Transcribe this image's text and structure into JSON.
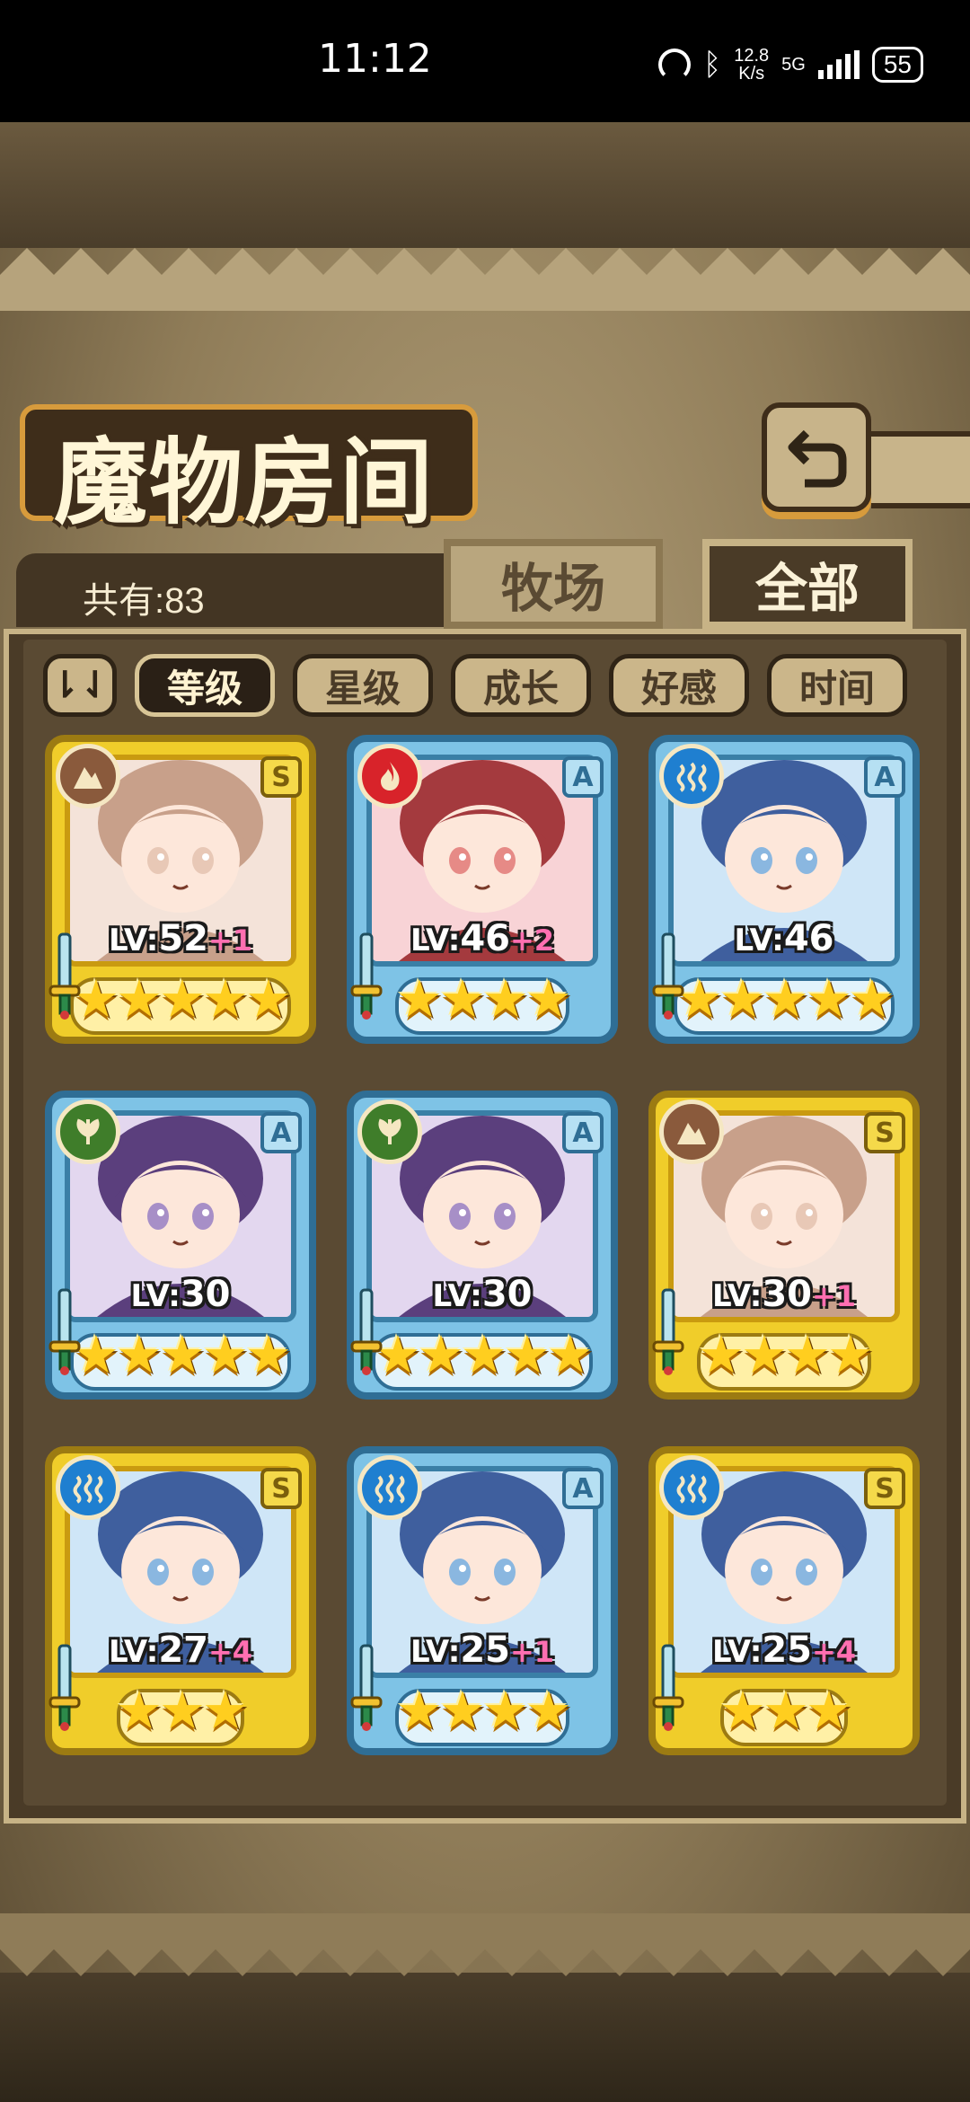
{
  "status_bar": {
    "time": "11:12",
    "net_speed_value": "12.8",
    "net_speed_unit": "K/s",
    "network_type": "5G",
    "battery": "55"
  },
  "header": {
    "title": "魔物房间",
    "back_icon": "return-arrow-icon"
  },
  "summary": {
    "count_label": "共有:83"
  },
  "tabs": [
    {
      "label": "牧场",
      "active": false
    },
    {
      "label": "全部",
      "active": true
    }
  ],
  "sort": {
    "toggle_label": "⇂⇃",
    "options": [
      {
        "label": "等级",
        "active": true
      },
      {
        "label": "星级",
        "active": false
      },
      {
        "label": "成长",
        "active": false
      },
      {
        "label": "好感",
        "active": false
      },
      {
        "label": "时间",
        "active": false
      }
    ]
  },
  "monsters": [
    {
      "element": "earth",
      "rank": "S",
      "frame": "gold",
      "level_prefix": "LV:",
      "level": "52",
      "bonus": "+1",
      "stars": 5
    },
    {
      "element": "fire",
      "rank": "A",
      "frame": "blue",
      "level_prefix": "LV:",
      "level": "46",
      "bonus": "+2",
      "stars": 4
    },
    {
      "element": "water",
      "rank": "A",
      "frame": "blue",
      "level_prefix": "LV:",
      "level": "46",
      "bonus": "",
      "stars": 5
    },
    {
      "element": "wood",
      "rank": "A",
      "frame": "blue",
      "level_prefix": "LV:",
      "level": "30",
      "bonus": "",
      "stars": 5
    },
    {
      "element": "wood",
      "rank": "A",
      "frame": "blue",
      "level_prefix": "LV:",
      "level": "30",
      "bonus": "",
      "stars": 5
    },
    {
      "element": "earth",
      "rank": "S",
      "frame": "gold",
      "level_prefix": "LV:",
      "level": "30",
      "bonus": "+1",
      "stars": 4
    },
    {
      "element": "water",
      "rank": "S",
      "frame": "gold",
      "level_prefix": "LV:",
      "level": "27",
      "bonus": "+4",
      "stars": 3
    },
    {
      "element": "water",
      "rank": "A",
      "frame": "blue",
      "level_prefix": "LV:",
      "level": "25",
      "bonus": "+1",
      "stars": 4
    },
    {
      "element": "water",
      "rank": "S",
      "frame": "gold",
      "level_prefix": "LV:",
      "level": "25",
      "bonus": "+4",
      "stars": 3
    }
  ],
  "colors": {
    "earth": "#8a5a3c",
    "fire": "#d8232a",
    "water": "#1f7fd0",
    "wood": "#3f7d2a",
    "star": "#ffce1f",
    "bonus": "#ff6fb1"
  }
}
